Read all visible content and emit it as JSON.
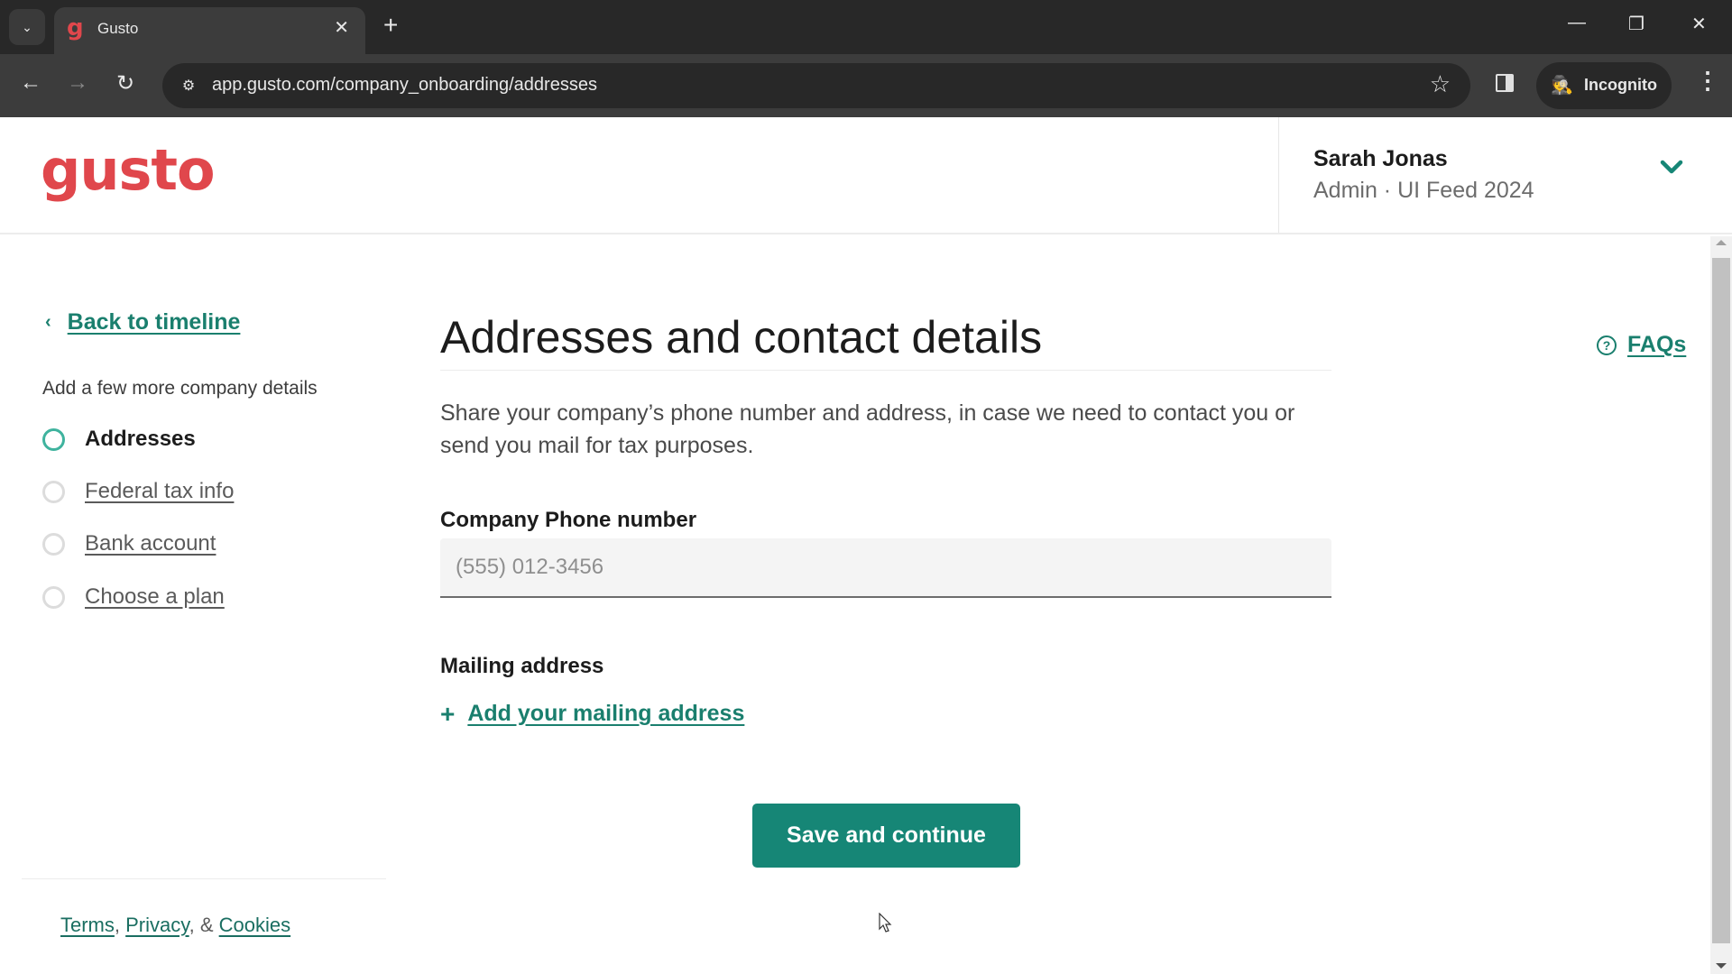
{
  "browser": {
    "tab_title": "Gusto",
    "tab_favicon": "g",
    "url": "app.gusto.com/company_onboarding/addresses",
    "incognito_label": "Incognito",
    "icons": {
      "tab_dropdown": "⌄",
      "close": "✕",
      "new_tab": "+",
      "minimize": "—",
      "restore": "❐",
      "window_close": "✕",
      "back": "←",
      "forward": "→",
      "reload": "↻",
      "site_info": "⚙",
      "star": "☆",
      "incognito": "🕵",
      "menu": "⋮"
    }
  },
  "header": {
    "logo": "gusto",
    "user_name": "Sarah Jonas",
    "user_sub": "Admin · UI Feed 2024"
  },
  "sidebar": {
    "back_label": "Back to timeline",
    "back_icon": "‹",
    "heading": "Add a few more company details",
    "steps": [
      {
        "label": "Addresses",
        "state": "active"
      },
      {
        "label": "Federal tax info",
        "state": "todo"
      },
      {
        "label": "Bank account",
        "state": "todo"
      },
      {
        "label": "Choose a plan",
        "state": "todo"
      }
    ],
    "footer": {
      "terms": "Terms",
      "sep1": ", ",
      "privacy": "Privacy",
      "sep2": ", & ",
      "cookies": "Cookies"
    }
  },
  "main": {
    "title": "Addresses and contact details",
    "faqs_label": "FAQs",
    "faqs_icon": "?",
    "description": "Share your company’s phone number and address, in case we need to contact you or send you mail for tax purposes.",
    "phone_label": "Company Phone number",
    "phone_value": "",
    "phone_placeholder": "(555) 012-3456",
    "mailing_label": "Mailing address",
    "add_mailing_label": "Add your mailing address",
    "add_icon": "+",
    "save_label": "Save and continue"
  },
  "colors": {
    "brand": "#e0474c",
    "accent": "#168676",
    "link": "#1a7f6e"
  }
}
